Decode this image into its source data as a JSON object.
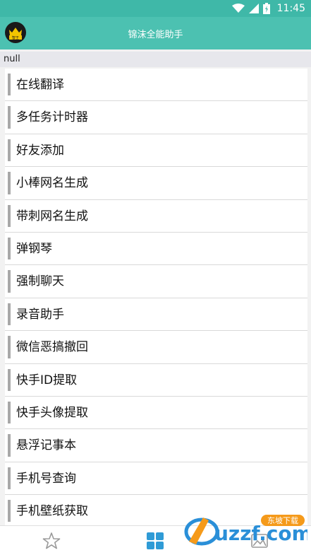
{
  "status_bar": {
    "time": "11:45"
  },
  "app_bar": {
    "logo_text": "智王",
    "title": "锦沫全能助手"
  },
  "subheader": {
    "text": "null"
  },
  "list": {
    "items": [
      {
        "label": "在线翻译"
      },
      {
        "label": "多任务计时器"
      },
      {
        "label": "好友添加"
      },
      {
        "label": "小棒网名生成"
      },
      {
        "label": "带刺网名生成"
      },
      {
        "label": "弹钢琴"
      },
      {
        "label": "强制聊天"
      },
      {
        "label": "录音助手"
      },
      {
        "label": "微信恶搞撤回"
      },
      {
        "label": "快手ID提取"
      },
      {
        "label": "快手头像提取"
      },
      {
        "label": "悬浮记事本"
      },
      {
        "label": "手机号查询"
      },
      {
        "label": "手机壁纸获取"
      }
    ]
  },
  "bottom_nav": {
    "items": [
      {
        "icon": "star-icon"
      },
      {
        "icon": "grid-icon",
        "active": true
      },
      {
        "icon": "image-icon"
      }
    ]
  },
  "watermark": {
    "brand": "uzzf.com",
    "tag": "东坡下载"
  },
  "colors": {
    "app_bar": "#4cc1b1",
    "status_bar": "#3fb8a8",
    "active_nav": "#2f9bd6"
  }
}
